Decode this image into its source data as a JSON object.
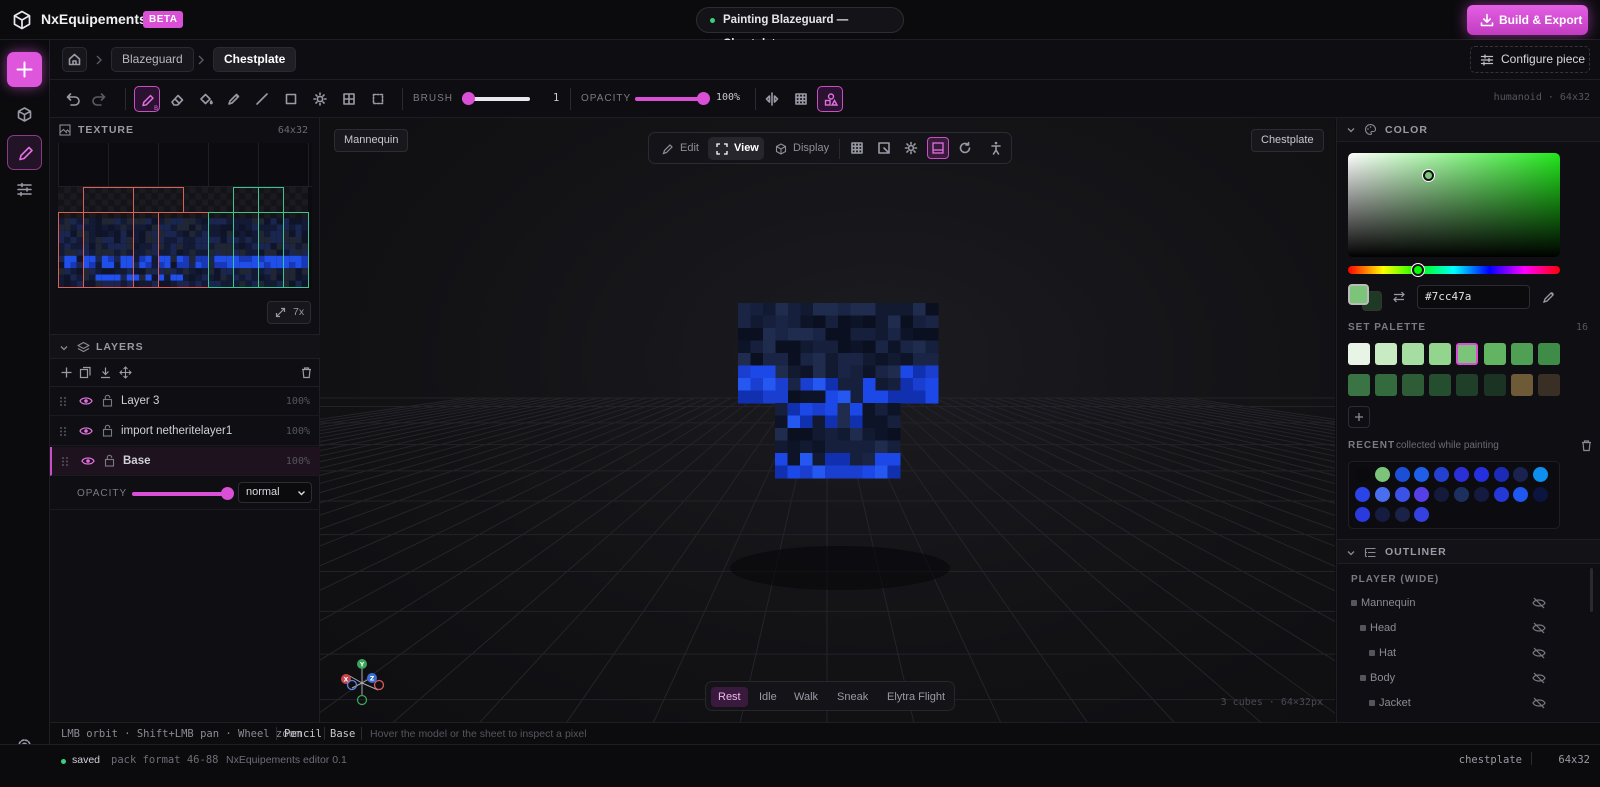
{
  "app": {
    "name": "NxEquipements",
    "badge": "BETA",
    "session": "Painting Blazeguard — Chestplate",
    "build_label": "Build & Export"
  },
  "breadcrumb": {
    "items": [
      "Blazeguard",
      "Chestplate"
    ],
    "configure_label": "Configure piece"
  },
  "toolbar": {
    "tools": [
      {
        "name": "pencil",
        "key": "B",
        "active": true
      },
      {
        "name": "eraser",
        "key": "E"
      },
      {
        "name": "fill",
        "key": "G"
      },
      {
        "name": "picker",
        "key": "I"
      },
      {
        "name": "line",
        "key": "L"
      },
      {
        "name": "rect",
        "key": "U"
      },
      {
        "name": "light",
        "key": "S"
      },
      {
        "name": "mirror",
        "key": "M"
      },
      {
        "name": "select",
        "key": "R"
      }
    ],
    "brush_label": "BRUSH",
    "brush_value": "1",
    "brush_level": 0.1,
    "opacity_label": "OPACITY",
    "opacity_value": "100%",
    "opacity_level": 1.0,
    "model_info": "humanoid · 64x32"
  },
  "texture": {
    "title": "TEXTURE",
    "size": "64x32",
    "zoom": "7x"
  },
  "layers": {
    "title": "LAYERS",
    "items": [
      {
        "name": "Layer 3",
        "opacity": "100%"
      },
      {
        "name": "import netheritelayer1",
        "opacity": "100%"
      },
      {
        "name": "Base",
        "opacity": "100%",
        "selected": true
      }
    ],
    "opacity_label": "OPACITY",
    "opacity_level": 0.95,
    "blend": "normal"
  },
  "viewport": {
    "left_tag": "Mannequin",
    "right_tag": "Chestplate",
    "modes": [
      {
        "label": "Edit"
      },
      {
        "label": "View",
        "active": true
      },
      {
        "label": "Display"
      }
    ],
    "animations": [
      {
        "label": "Rest",
        "active": true
      },
      {
        "label": "Idle"
      },
      {
        "label": "Walk"
      },
      {
        "label": "Sneak"
      },
      {
        "label": "Elytra Flight"
      }
    ],
    "info": "3 cubes · 64×32px"
  },
  "color": {
    "title": "COLOR",
    "hex": "#7cc47a",
    "current": "#7cc47a",
    "secondary": "#1f3a24",
    "hue_level": 0.33,
    "palette_label": "SET PALETTE",
    "palette_count": "16",
    "palette": [
      "#e8f4e6",
      "#c8ebc4",
      "#a6dea1",
      "#93d48e",
      "#7cc47a",
      "#62b462",
      "#4fa054",
      "#3f8c48",
      "#3a7444",
      "#336a3e",
      "#2d5c36",
      "#254e30",
      "#1f3f28",
      "#1a3322",
      "#6e5a36",
      "#3a2f24"
    ],
    "recent_label": "RECENT",
    "recent_note": "collected while painting",
    "recent": [
      "#0a0a0e",
      "#7cc47a",
      "#1a4fd6",
      "#1e5ee8",
      "#2440d0",
      "#2a2fd8",
      "#2430e0",
      "#1c2ab8",
      "#1a2250",
      "#0e8ff0",
      "#2a44e8",
      "#4a6ef0",
      "#3a52e8",
      "#5540e8",
      "#141a3a",
      "#1c3060",
      "#141a40",
      "#2438d8",
      "#1e58ee",
      "#0c1440",
      "#2a3adf",
      "#161c40",
      "#1a2248",
      "#3440e0"
    ]
  },
  "outliner": {
    "title": "OUTLINER",
    "group": "PLAYER (WIDE)",
    "items": [
      {
        "label": "Mannequin",
        "depth": 0
      },
      {
        "label": "Head",
        "depth": 1
      },
      {
        "label": "Hat",
        "depth": 2
      },
      {
        "label": "Body",
        "depth": 1
      },
      {
        "label": "Jacket",
        "depth": 2
      }
    ]
  },
  "hints": {
    "controls": "LMB orbit · Shift+LMB pan · Wheel zoom",
    "tool": "Pencil",
    "layer": "Base",
    "message": "Hover the model or the sheet to inspect a pixel"
  },
  "status": {
    "saved": "saved",
    "pack": "pack format 46-88",
    "editor": "NxEquipements editor 0.1",
    "piece": "chestplate",
    "size": "64x32"
  }
}
